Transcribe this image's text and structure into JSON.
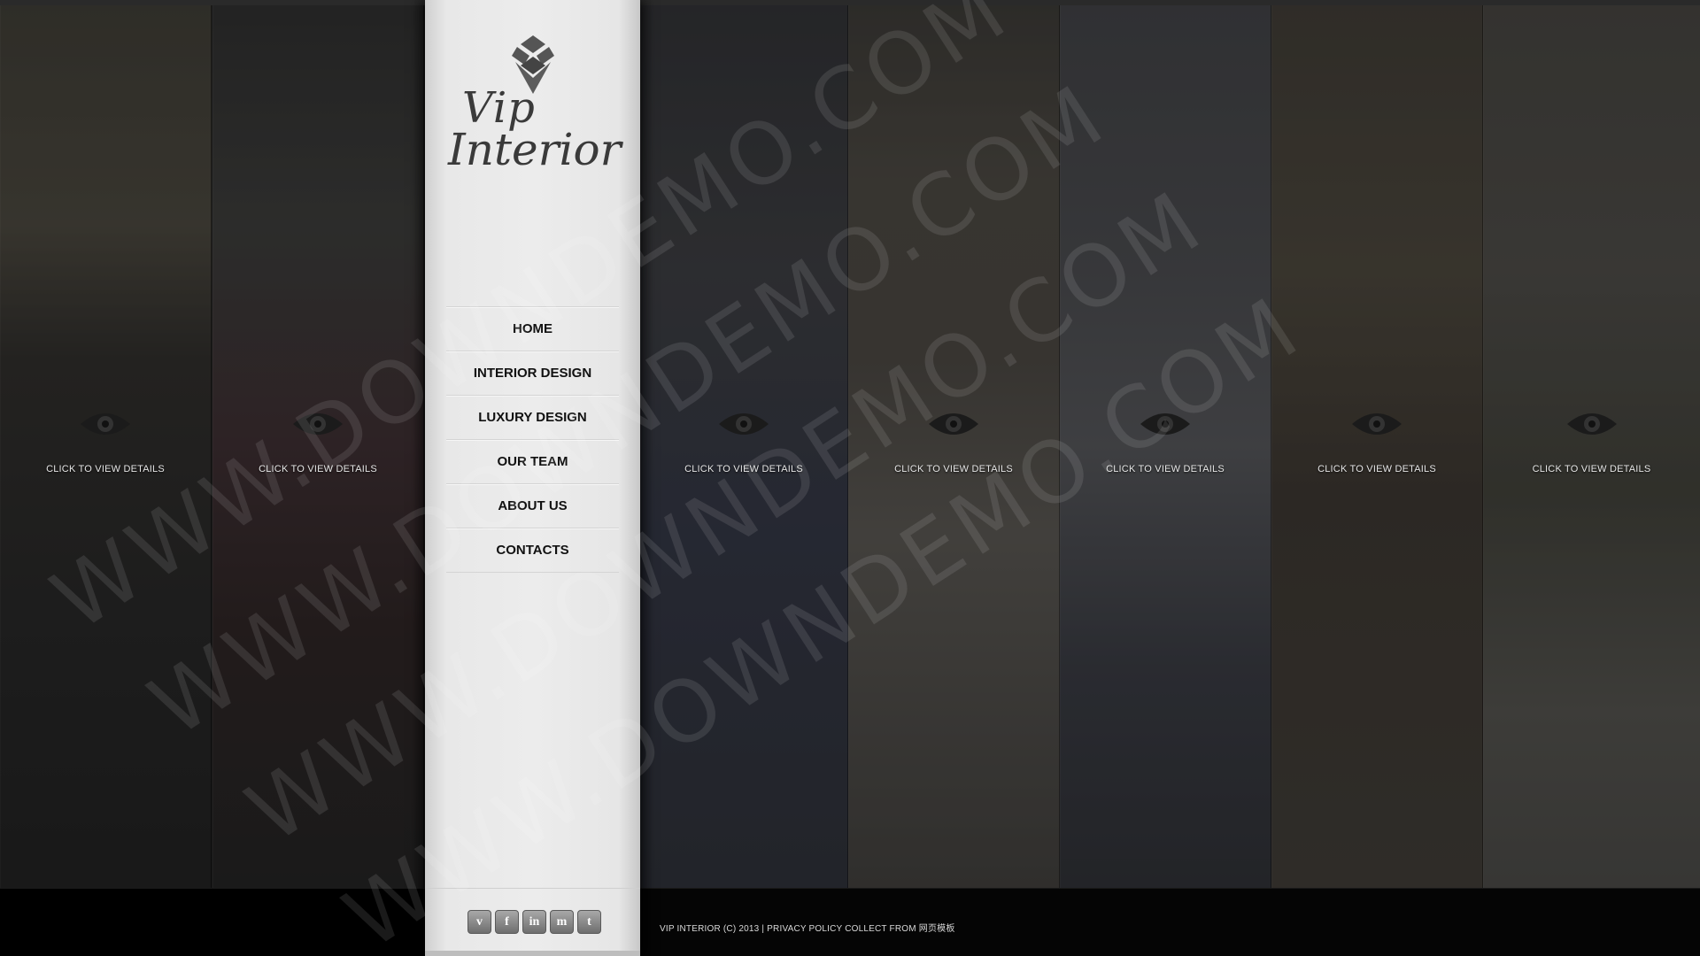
{
  "brand": {
    "name_line1": "Vip",
    "name_line2": "Interior"
  },
  "nav": {
    "items": [
      "HOME",
      "INTERIOR DESIGN",
      "LUXURY DESIGN",
      "OUR TEAM",
      "ABOUT US",
      "CONTACTS"
    ]
  },
  "gallery": {
    "cta_label": "CLICK TO VIEW DETAILS",
    "panels": [
      {
        "cta": "CLICK TO VIEW DETAILS"
      },
      {
        "cta": "CLICK TO VIEW DETAILS"
      },
      {
        "cta": "CLICK TO VIEW DETAILS"
      },
      {
        "cta": "CLICK TO VIEW DETAILS"
      },
      {
        "cta": "CLICK TO VIEW DETAILS"
      },
      {
        "cta": "CLICK TO VIEW DETAILS"
      },
      {
        "cta": "CLICK TO VIEW DETAILS"
      }
    ]
  },
  "socials": {
    "icons": [
      "vimeo-icon",
      "facebook-icon",
      "linkedin-icon",
      "myspace-icon",
      "twitter-icon"
    ],
    "glyphs": [
      "v",
      "f",
      "in",
      "m",
      "t"
    ]
  },
  "footer": {
    "copyright": "VIP INTERIOR (C) 2013",
    "separator": "|",
    "privacy": "PRIVACY POLICY COLLECT FROM 网页模板"
  },
  "watermark": {
    "text": "WWW.DOWNDEMO.COM"
  }
}
